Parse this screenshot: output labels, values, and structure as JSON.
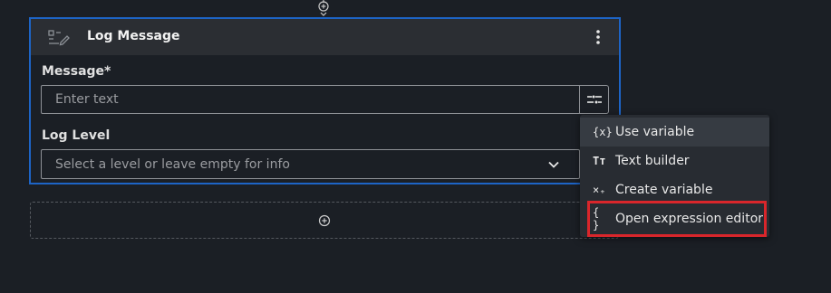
{
  "card": {
    "title": "Log Message",
    "accent_color": "#1d64c6"
  },
  "message_field": {
    "label": "Message*",
    "placeholder": "Enter text"
  },
  "log_level_field": {
    "label": "Log Level",
    "placeholder": "Select a level or leave empty for info"
  },
  "context_menu": {
    "items": [
      {
        "icon": "variable-icon",
        "glyph": "{x}",
        "label": "Use variable"
      },
      {
        "icon": "text-builder-icon",
        "glyph": "Tт",
        "label": "Text builder"
      },
      {
        "icon": "create-variable-icon",
        "glyph": "×₊",
        "label": "Create variable"
      },
      {
        "icon": "expression-icon",
        "glyph": "{ }",
        "label": "Open expression editor"
      }
    ],
    "highlight_color": "#d9262b"
  }
}
